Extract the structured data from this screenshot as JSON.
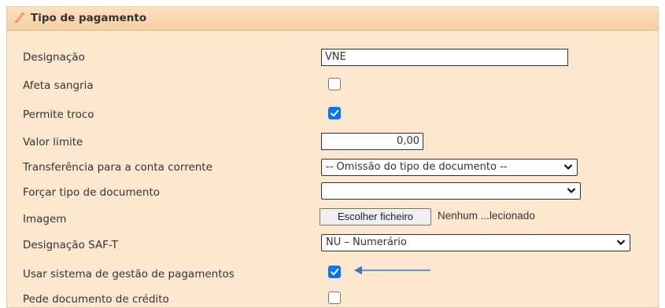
{
  "header": {
    "title": "Tipo de pagamento"
  },
  "form": {
    "designacao": {
      "label": "Designação",
      "value": "VNE"
    },
    "afeta_sangria": {
      "label": "Afeta sangria",
      "checked": false
    },
    "permite_troco": {
      "label": "Permite troco",
      "checked": true
    },
    "valor_limite": {
      "label": "Valor limite",
      "value": "0,00"
    },
    "transferencia": {
      "label": "Transferência para a conta corrente",
      "selected": "-- Omissão do tipo de documento --"
    },
    "forcar_tipo": {
      "label": "Forçar tipo de documento",
      "selected": ""
    },
    "imagem": {
      "label": "Imagem",
      "button_label": "Escolher ficheiro",
      "status": "Nenhum ...lecionado"
    },
    "designacao_saft": {
      "label": "Designação SAF-T",
      "selected": "NU – Numerário"
    },
    "usar_sistema": {
      "label": "Usar sistema de gestão de pagamentos",
      "checked": true
    },
    "pede_documento": {
      "label": "Pede documento de crédito",
      "checked": false
    }
  },
  "colors": {
    "panel_bg": "#fde8cf",
    "title_bg": "#f7cfa2",
    "checkbox_accent": "#0075ff",
    "arrow": "#4472c4"
  }
}
